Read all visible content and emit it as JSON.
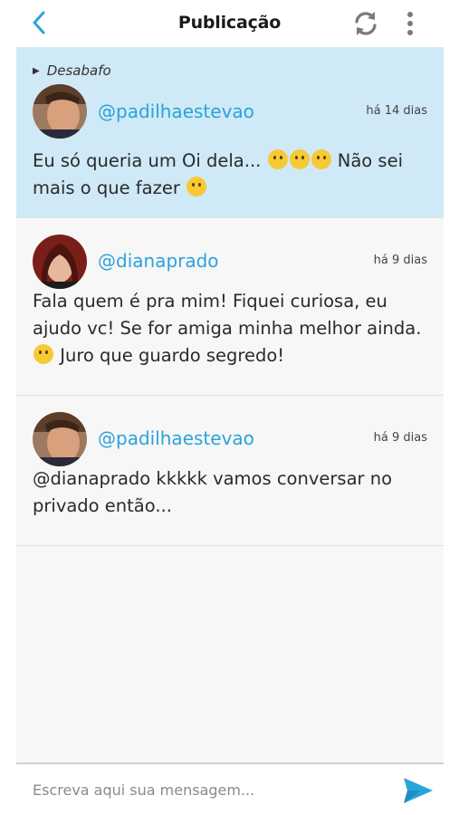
{
  "header": {
    "title": "Publicação",
    "back_icon": "chevron-left-icon",
    "refresh_icon": "refresh-icon",
    "menu_icon": "more-vertical-icon",
    "accent_color": "#29a3dc"
  },
  "posts": [
    {
      "category": "Desabafo",
      "username": "@padilhaestevao",
      "time": "há 14 dias",
      "text_before_emoji": "Eu só queria um Oi dela...",
      "emojis_inline": [
        "crying-face-emoji",
        "downcast-sweat-emoji",
        "persevering-face-emoji"
      ],
      "text_after_emoji": "Não sei mais o que fazer",
      "emoji_end": "tired-face-emoji",
      "highlight_color": "#cfe9f7"
    },
    {
      "username": "@dianaprado",
      "time": "há 9 dias",
      "text_line1": "Fala quem é pra mim! Fiquei curiosa, eu",
      "text_line2": "ajudo vc! Se for amiga minha melhor ainda.",
      "text_line3": "Juro que guardo segredo!",
      "emoji": "smiling-face-emoji"
    },
    {
      "username": "@padilhaestevao",
      "time": "há 9 dias",
      "text_line1": "@dianaprado kkkkk vamos conversar no",
      "text_line2": "privado então..."
    }
  ],
  "composer": {
    "placeholder": "Escreva aqui sua mensagem...",
    "send_icon": "send-icon"
  }
}
